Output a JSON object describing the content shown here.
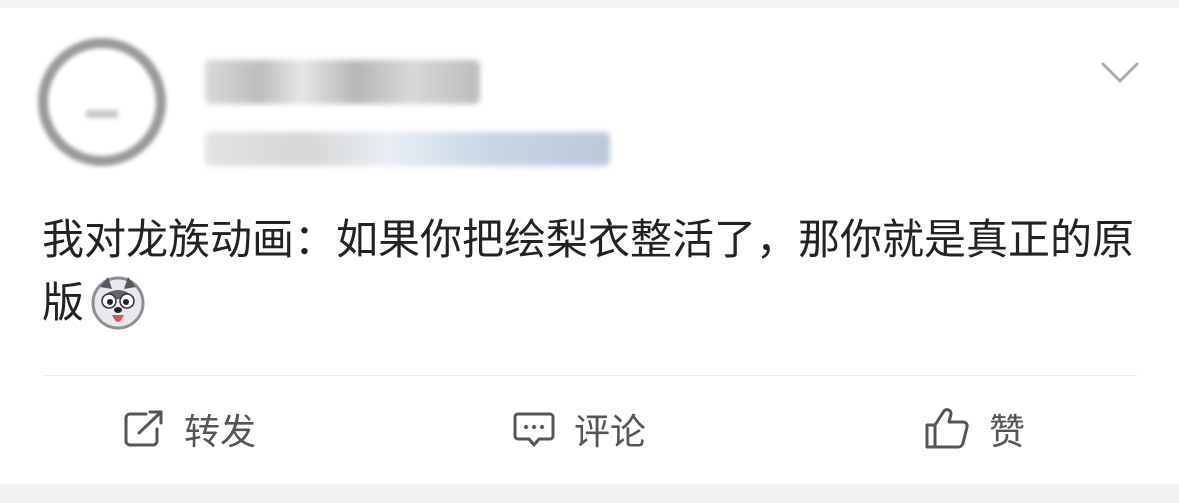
{
  "post": {
    "content": "我对龙族动画：如果你把绘梨衣整活了，那你就是真正的原版"
  },
  "actions": {
    "share_label": "转发",
    "comment_label": "评论",
    "like_label": "赞"
  },
  "icons": {
    "more": "chevron-down-icon",
    "emoji": "husky-tongue-emoji",
    "share": "share-square-arrow-icon",
    "comment": "comment-bubble-icon",
    "like": "thumbs-up-icon"
  }
}
